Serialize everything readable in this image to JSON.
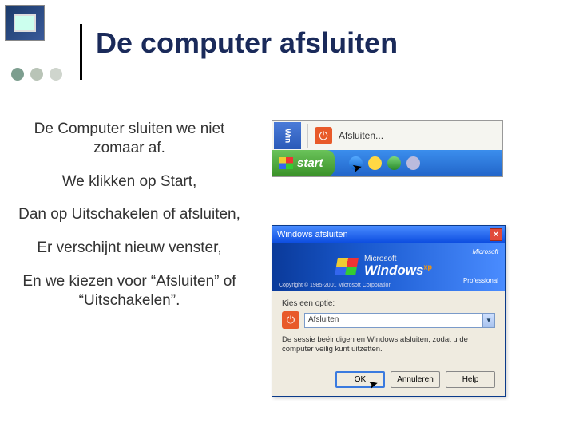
{
  "title": "De computer afsluiten",
  "bullets": {
    "p1": "De Computer sluiten we niet zomaar af.",
    "p2": "We klikken op Start,",
    "p3": "Dan op Uitschakelen of afsluiten,",
    "p4": "Er verschijnt nieuw venster,",
    "p5": "En we kiezen voor “Afsluiten” of “Uitschakelen”."
  },
  "start_shot": {
    "win_label": "Win",
    "menu_item": "Afsluiten...",
    "start_label": "start"
  },
  "dialog": {
    "title": "Windows afsluiten",
    "brand": "Microsoft",
    "product": "Windows",
    "edition_suffix": "xp",
    "professional": "Professional",
    "ms_small": "Microsoft",
    "copyright": "Copyright © 1985-2001  Microsoft Corporation",
    "prompt": "Kies een optie:",
    "selected": "Afsluiten",
    "description": "De sessie beëindigen en Windows afsluiten, zodat u de computer veilig kunt uitzetten.",
    "ok": "OK",
    "cancel": "Annuleren",
    "help": "Help"
  }
}
